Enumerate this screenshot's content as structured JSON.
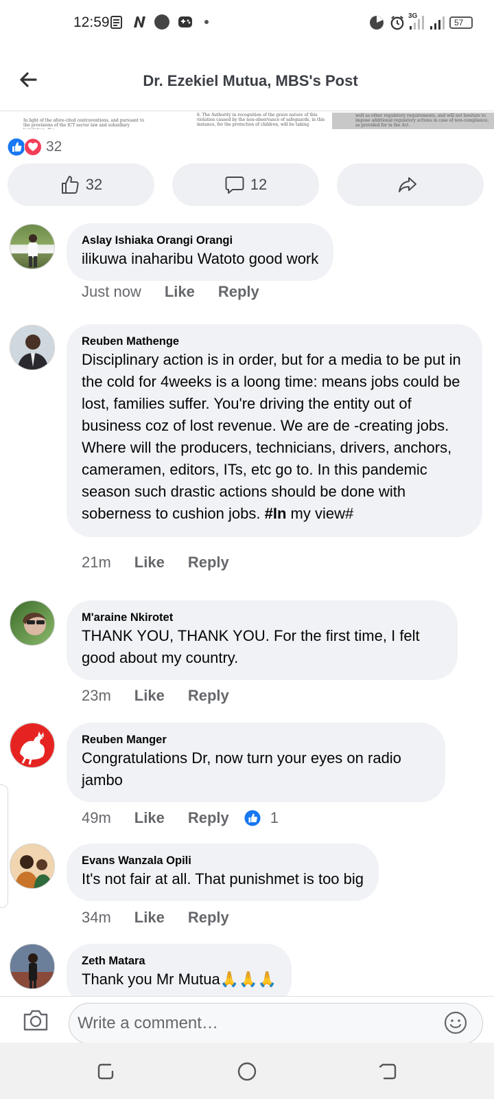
{
  "status_bar": {
    "time": "12:59",
    "network": "3G",
    "battery": "57"
  },
  "header": {
    "title": "Dr. Ezekiel Mutua, MBS's Post"
  },
  "document_strip": {
    "fragment_left": "In light of the afore-cited contraventions, and pursuant to the provisions of the ICT sector law and subsidiary legislation, the",
    "fragment_middle": "6. The Authority in recognition of the grave nature of this violation caused by the non-observance of safeguards, in this instance, for the protection of children, will be taking",
    "fragment_right": "well as other regulatory requirements, and will not hesitate to impose additional regulatory actions in case of non-compliance, as provided for in the Act."
  },
  "reactions": {
    "count": "32"
  },
  "actions": {
    "like_count": "32",
    "comment_count": "12"
  },
  "comments": [
    {
      "author": "Aslay Ishiaka Orangi Orangi",
      "text": "ilikuwa inaharibu Watoto good work",
      "time": "Just now",
      "like": "Like",
      "reply": "Reply"
    },
    {
      "author": "Reuben Mathenge",
      "text": "Disciplinary action is in order, but for a media to be put in the cold for 4weeks is a loong time: means jobs could be lost, families suffer. You're driving the entity out of business coz of lost revenue. We are de -creating jobs. Where will the producers, technicians, drivers, anchors, cameramen, editors, ITs, etc go to. In this pandemic season such drastic actions should be done with soberness to cushion jobs.",
      "hashtag": "#In",
      "text_after": " my view#",
      "time": "21m",
      "like": "Like",
      "reply": "Reply"
    },
    {
      "author": "M'araine Nkirotet",
      "text": "THANK YOU, THANK YOU. For the first time, I felt good about my country.",
      "time": "23m",
      "like": "Like",
      "reply": "Reply"
    },
    {
      "author": "Reuben Manger",
      "text": "Congratulations Dr, now turn your eyes on radio jambo",
      "time": "49m",
      "like": "Like",
      "reply": "Reply",
      "reaction_count": "1"
    },
    {
      "author": "Evans Wanzala Opili",
      "text": "It's not fair at all. That punishmet is too big",
      "time": "34m",
      "like": "Like",
      "reply": "Reply"
    },
    {
      "author": "Zeth Matara",
      "text": "Thank you Mr Mutua🙏🙏🙏"
    }
  ],
  "composer": {
    "placeholder": "Write a comment…"
  },
  "colors": {
    "bubble": "#f0f2f5",
    "like_blue": "#1877f2",
    "love_red": "#f33e58",
    "meta_gray": "#65676b"
  },
  "icons": {
    "back": "arrow-left-icon",
    "like": "thumbs-up-icon",
    "comment": "speech-bubble-icon",
    "share": "share-arrow-icon",
    "camera": "camera-icon",
    "emoji": "smiley-icon"
  }
}
